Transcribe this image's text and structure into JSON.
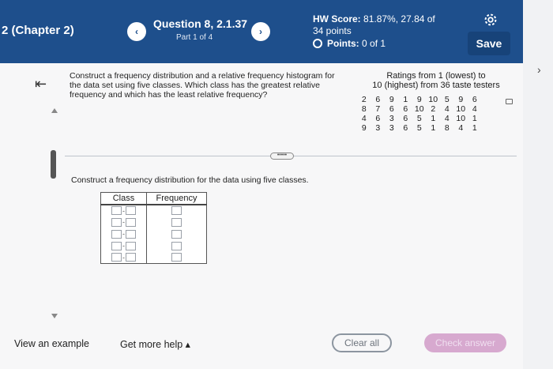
{
  "header": {
    "chapter": "2 (Chapter 2)",
    "question_title": "Question 8, 2.1.37",
    "question_part": "Part 1 of 4",
    "hw_score_label": "HW Score:",
    "hw_score_value": "81.87%, 27.84 of",
    "hw_score_points": "34 points",
    "points_label": "Points:",
    "points_value": "0 of 1",
    "save_label": "Save",
    "prev_icon": "‹",
    "next_icon": "›"
  },
  "question": {
    "text": "Construct a frequency distribution and a relative frequency histogram for the data set using five classes. Which class has the greatest relative frequency and which has the least relative frequency?",
    "ratings_title_line1": "Ratings from 1 (lowest) to",
    "ratings_title_line2": "10 (highest) from 36 taste testers",
    "ratings_rows": [
      [
        "2",
        "6",
        "9",
        "1",
        "9",
        "10",
        "5",
        "9",
        "6"
      ],
      [
        "8",
        "7",
        "6",
        "6",
        "10",
        "2",
        "4",
        "10",
        "4"
      ],
      [
        "4",
        "6",
        "3",
        "6",
        "5",
        "1",
        "4",
        "10",
        "1"
      ],
      [
        "9",
        "3",
        "3",
        "6",
        "5",
        "1",
        "8",
        "4",
        "1"
      ]
    ],
    "more_label": "•••••",
    "instruction": "Construct a frequency distribution for the data using five classes.",
    "table_headers": [
      "Class",
      "Frequency"
    ],
    "table_rows": 5
  },
  "footer": {
    "view_example": "View an example",
    "get_help": "Get more help ▴",
    "clear_all": "Clear all",
    "check_answer": "Check answer"
  },
  "colors": {
    "header_bg": "#1e4f8c",
    "save_bg": "#174379",
    "check_answer_bg": "#d7a9cf"
  }
}
